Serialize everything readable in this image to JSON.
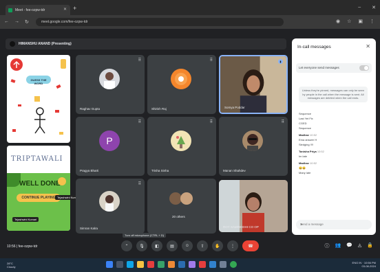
{
  "browser": {
    "tab_title": "Meet - fee-ozpw-tdr",
    "url": "meet.google.com/fee-ozpw-tdr"
  },
  "presenter": {
    "label": "HIMANSHU ANAND (Presenting)"
  },
  "slides": {
    "game_caption": "GUESS THE WORD",
    "title": "TRIPTAWALI",
    "well_done": "WELL DONE!",
    "continue": "CONTINUE PLAYING",
    "name_tag_1": "Tejashwini Kumari",
    "name_tag_2": "Tejashwini Kumari"
  },
  "participants": [
    {
      "name": "Raghav Gupta"
    },
    {
      "name": "Shirish Raj"
    },
    {
      "name": "Somya Poddar"
    },
    {
      "name": "Pragya Bharti",
      "initial": "P"
    },
    {
      "name": "Trisha Sinha"
    },
    {
      "name": "Manan Shahdev"
    },
    {
      "name": "Simran Kalra"
    },
    {
      "name": "20 others"
    },
    {
      "name": "ROY SAMRIDDHI CO OP"
    }
  ],
  "chat": {
    "title": "In-call messages",
    "toggle_label": "Let everyone send messages",
    "notice": "Unless they're pinned, messages can only be seen by people in the call when the message is sent. All messages are deleted when the call ends.",
    "lines": [
      "Sequence",
      "Last Yet Fix",
      "CGED",
      "Sequence"
    ],
    "messages": [
      {
        "sender": "Madhav",
        "time": "10:52",
        "lines": [
          "Ema answer H",
          "Sledging !!!!"
        ]
      },
      {
        "sender": "Tanisha Priya",
        "time": "10:52",
        "lines": [
          "Im late"
        ]
      },
      {
        "sender": "Madhav",
        "time": "10:52",
        "lines": [
          "😀😀",
          "Many late"
        ]
      }
    ],
    "input_placeholder": "Send a message"
  },
  "meeting": {
    "time": "10:56",
    "code": "fee-ozpw-tdr",
    "tooltip": "Turn off microphone (CTRL + D)"
  },
  "taskbar": {
    "weather_temp": "28°C",
    "weather_desc": "Cloudy",
    "clock_time": "10:56 PM",
    "clock_date": "03-08-2024",
    "lang": "ENG IN"
  },
  "colors": {
    "accent": "#8ab4f8",
    "end_call": "#ea4335",
    "meet_bg": "#202124",
    "tile_bg": "#3c4043"
  }
}
